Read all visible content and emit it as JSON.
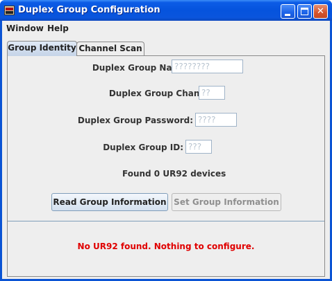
{
  "window": {
    "title": "Duplex Group Configuration"
  },
  "menubar": {
    "items": [
      "Window",
      "Help"
    ]
  },
  "tabs": [
    {
      "label": "Group Identity",
      "active": true
    },
    {
      "label": "Channel Scan",
      "active": false
    }
  ],
  "form": {
    "name_label": "Duplex Group Name:",
    "name_placeholder": "????????",
    "channel_label": "Duplex Group Channel:",
    "channel_placeholder": "??",
    "password_label": "Duplex Group Password:",
    "password_placeholder": "????",
    "id_label": "Duplex Group ID:",
    "id_placeholder": "???"
  },
  "status": {
    "devices_found": "Found 0 UR92 devices",
    "error_message": "No UR92 found.  Nothing to configure.",
    "error_color": "#e00000"
  },
  "buttons": {
    "read_label": "Read Group Information",
    "set_label": "Set Group Information",
    "set_enabled": false
  },
  "icons": {
    "app": "app-icon",
    "minimize": "minimize-icon",
    "maximize": "maximize-icon",
    "close": "close-icon"
  }
}
